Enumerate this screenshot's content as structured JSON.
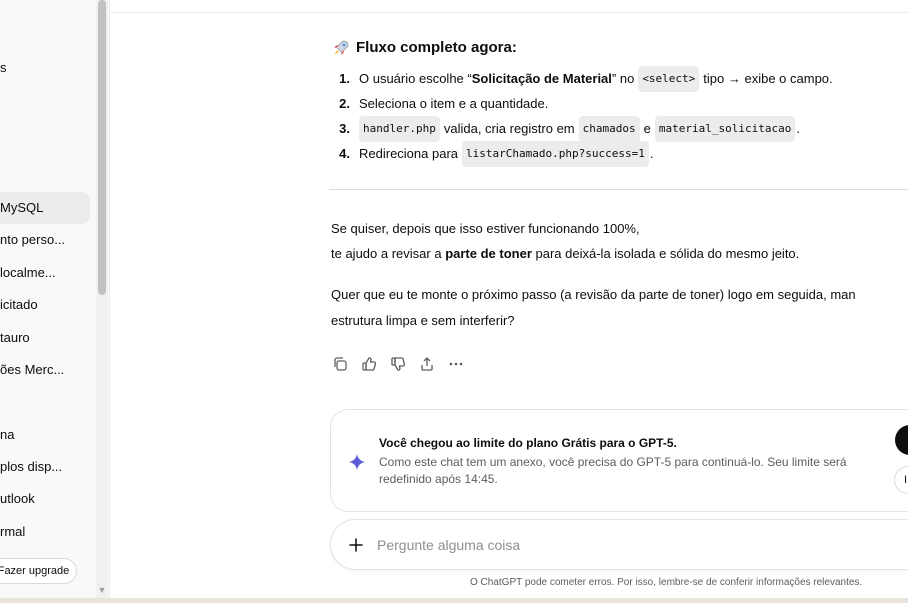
{
  "sidebar": {
    "items": [
      {
        "label": "s",
        "active": false
      },
      {
        "label": "MySQL",
        "active": true
      },
      {
        "label": "nto perso...",
        "active": false
      },
      {
        "label": " localme...",
        "active": false
      },
      {
        "label": "icitado",
        "active": false
      },
      {
        "label": "tauro",
        "active": false
      },
      {
        "label": "ões Merc...",
        "active": false
      },
      {
        "label": "na",
        "active": false
      },
      {
        "label": "plos disp...",
        "active": false
      },
      {
        "label": "utlook",
        "active": false
      },
      {
        "label": "rmal",
        "active": false
      }
    ],
    "upgrade_label": "Fazer upgrade"
  },
  "message": {
    "section_title": "Fluxo completo agora:",
    "steps": [
      {
        "num": "1.",
        "parts": [
          "O usuário escolhe “",
          "Solicitação de Material",
          "” no",
          "<select>",
          "tipo → exibe o campo."
        ]
      },
      {
        "num": "2.",
        "text": "Seleciona o item e a quantidade."
      },
      {
        "num": "3.",
        "parts": [
          "handler.php",
          "valida, cria registro em",
          "chamados",
          "e",
          "material_solicitacao",
          "."
        ]
      },
      {
        "num": "4.",
        "parts": [
          "Redireciona para",
          "listarChamado.php?success=1",
          "."
        ]
      }
    ],
    "para1_line1": "Se quiser, depois que isso estiver funcionando 100%,",
    "para1_line2_pre": "te ajudo a revisar a",
    "para1_line2_bold": "parte de toner",
    "para1_line2_post": "para deixá-la isolada e sólida do mesmo jeito.",
    "para2_line1": "Quer que eu te monte o próximo passo (a revisão da parte de toner) logo em seguida, man",
    "para2_line2": "estrutura limpa e sem interferir?"
  },
  "actions": [
    "copy-icon",
    "thumbs-up-icon",
    "thumbs-down-icon",
    "share-icon",
    "more-icon"
  ],
  "limit": {
    "title": "Você chegou ao limite do plano Grátis para o GPT-5.",
    "text": "Como este chat tem um anexo, você precisa do GPT-5 para continuá-lo. Seu limite será redefinido após 14:45.",
    "secondary_button_fragment": "I"
  },
  "input": {
    "placeholder": "Pergunte alguma coisa"
  },
  "disclaimer": "O ChatGPT pode cometer erros. Por isso, lembre-se de conferir informações relevantes.",
  "colors": {
    "accent_sparkle": "#5b5bd6",
    "text": "#0d0d0d",
    "muted": "#5d5d5d"
  }
}
